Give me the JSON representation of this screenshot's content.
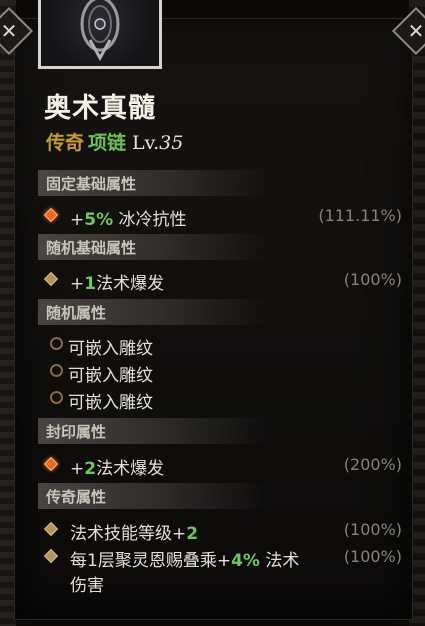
{
  "item": {
    "name": "奥术真髓",
    "rarity": "传奇",
    "slot": "项链",
    "level_prefix": "Lv.",
    "level": "35"
  },
  "sections": {
    "fixed_base": "固定基础属性",
    "random_base": "随机基础属性",
    "random_affix": "随机属性",
    "sealed": "封印属性",
    "legendary": "传奇属性"
  },
  "fixed_base_affix": {
    "plus": "+",
    "value": "5%",
    "name": " 冰冷抗性",
    "percent": "(111.11%)"
  },
  "random_base_affix": {
    "plus": "+",
    "value": "1",
    "name": "法术爆发",
    "percent": "(100%)"
  },
  "sockets": [
    "可嵌入雕纹",
    "可嵌入雕纹",
    "可嵌入雕纹"
  ],
  "sealed_affix": {
    "plus": "+",
    "value": "2",
    "name": "法术爆发",
    "percent": "(200%)"
  },
  "legendary_affixes": [
    {
      "prefix": "法术技能等级+",
      "value": "2",
      "percent": "(100%)"
    },
    {
      "prefix": "每1层聚灵恩赐叠乘+",
      "value": "4%",
      "suffix": " 法术",
      "line2": "伤害",
      "percent": "(100%)"
    }
  ],
  "colors": {
    "legendary": "#c6993a",
    "slot": "#6fbe5c",
    "value_green": "#72c564",
    "percent_gray": "#86827c",
    "affix_marker_orange": "#e8692a",
    "affix_marker_gold": "#b3955c"
  },
  "icons": [
    "close-icon",
    "necklace-item-icon",
    "affix-diamond-icon",
    "socket-ring-icon"
  ]
}
